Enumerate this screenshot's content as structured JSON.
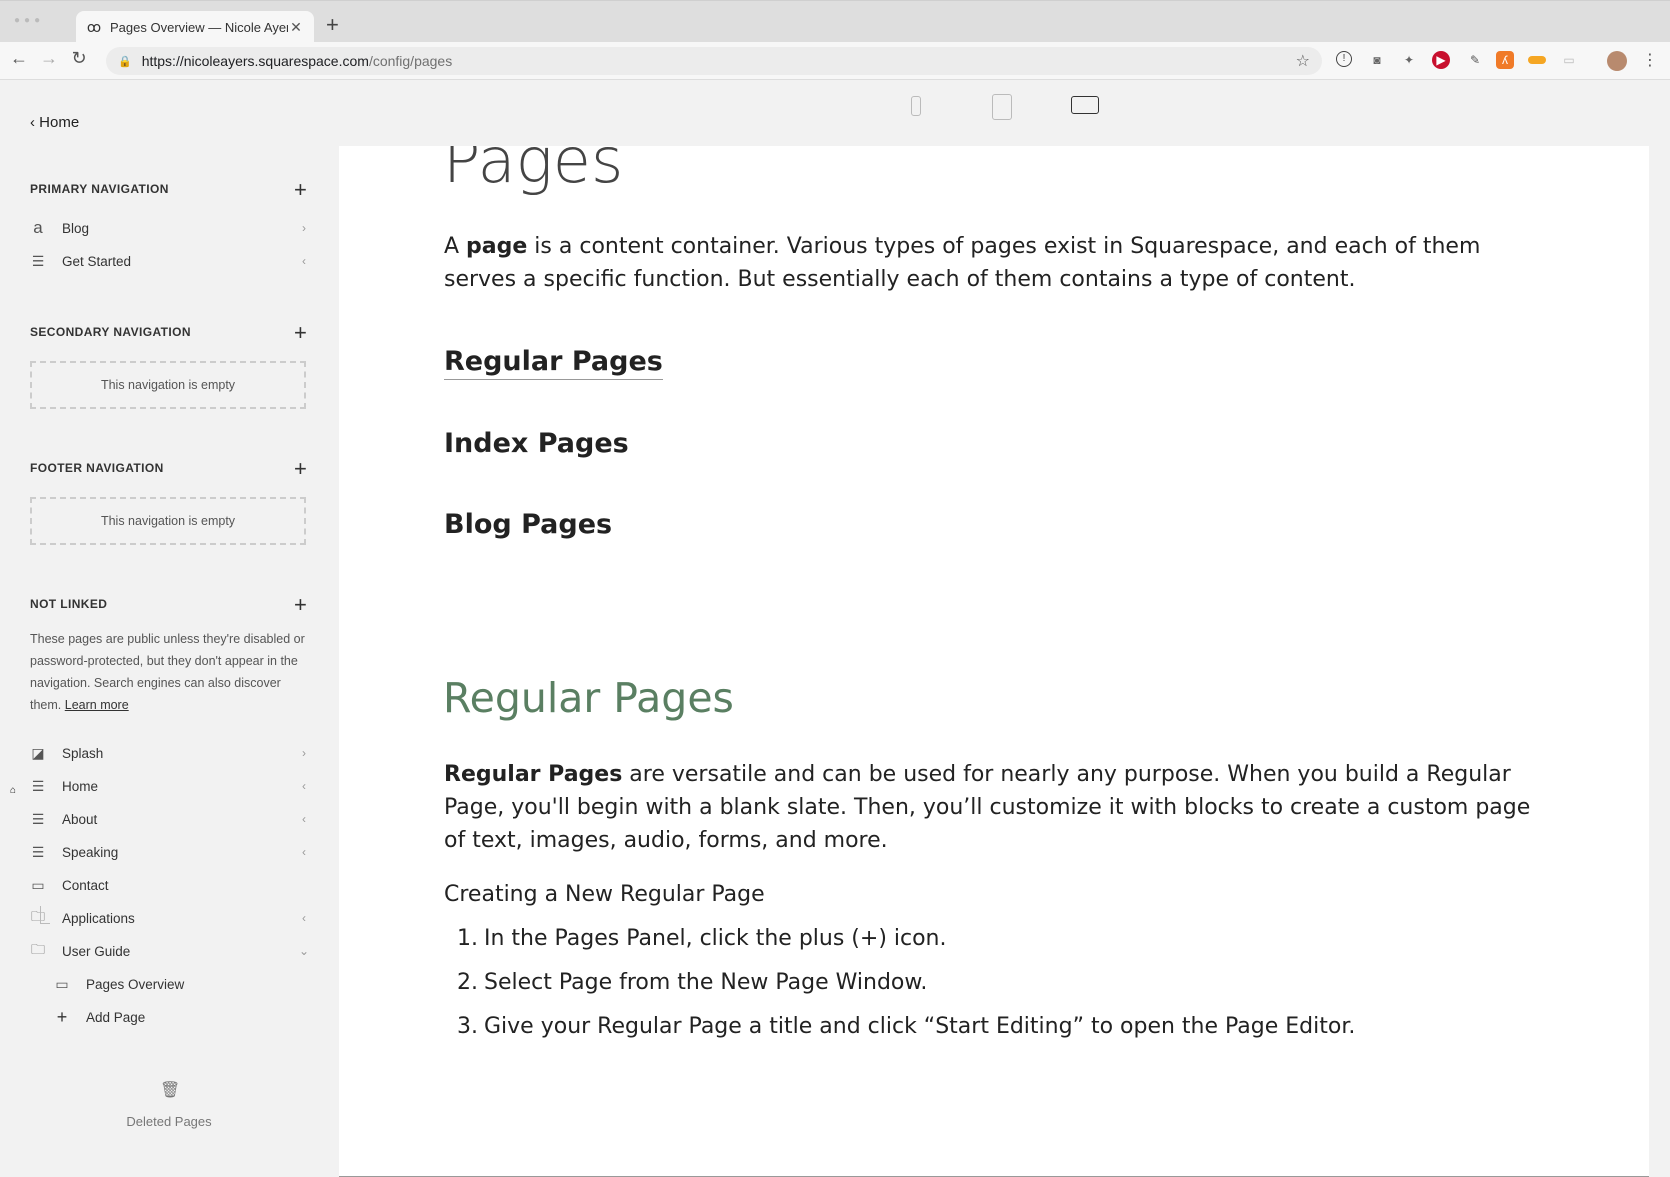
{
  "browser": {
    "tab_title": "Pages Overview — Nicole Ayers",
    "url_host": "https://nicoleayers.squarespace.com",
    "url_path": "/config/pages"
  },
  "sidebar": {
    "home_label": "Home",
    "primary": {
      "heading": "PRIMARY NAVIGATION",
      "items": [
        {
          "label": "Blog",
          "icon": "blog-icon"
        },
        {
          "label": "Get Started",
          "icon": "layout-icon"
        }
      ]
    },
    "secondary": {
      "heading": "SECONDARY NAVIGATION",
      "empty": "This navigation is empty"
    },
    "footer": {
      "heading": "FOOTER NAVIGATION",
      "empty": "This navigation is empty"
    },
    "not_linked": {
      "heading": "NOT LINKED",
      "note": "These pages are public unless they're disabled or password-protected, but they don't appear in the navigation. Search engines can also discover them.",
      "learn_more": "Learn more",
      "items": [
        {
          "label": "Splash",
          "icon": "cover-page-icon"
        },
        {
          "label": "Home",
          "icon": "layout-icon"
        },
        {
          "label": "About",
          "icon": "layout-icon"
        },
        {
          "label": "Speaking",
          "icon": "layout-icon"
        },
        {
          "label": "Contact",
          "icon": "page-icon"
        },
        {
          "label": "Applications",
          "icon": "folder-icon"
        },
        {
          "label": "User Guide",
          "icon": "folder-icon"
        }
      ],
      "sub_item": "Pages Overview",
      "add_page": "Add Page"
    },
    "deleted_pages": "Deleted Pages"
  },
  "content": {
    "title": "Pages",
    "intro_pre": "A ",
    "intro_bold": "page",
    "intro_post": " is a content container. Various types of pages exist in Squarespace, and each of them serves a specific function. But essentially each of them contains a type of content.",
    "toc": [
      "Regular Pages",
      "Index Pages",
      "Blog Pages"
    ],
    "section_heading": "Regular Pages",
    "section_bold": "Regular Pages",
    "section_text": " are versatile and can be used for nearly any purpose. When you build a Regular Page, you'll begin with a blank slate. Then, you’ll customize it with blocks to create a custom page of text, images, audio, forms, and more.",
    "subheading": "Creating a New Regular Page",
    "steps": [
      "In the Pages Panel, click the plus (+) icon.",
      "Select Page from the New Page Window.",
      "Give your Regular Page a title and click “Start Editing” to open the Page Editor."
    ]
  },
  "colors": {
    "heading_green": "#5a7f62"
  }
}
